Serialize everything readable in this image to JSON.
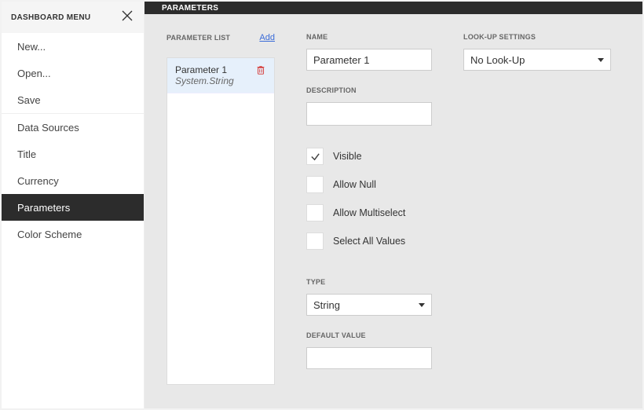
{
  "sidebar": {
    "title": "DASHBOARD MENU",
    "items_a": [
      {
        "label": "New..."
      },
      {
        "label": "Open..."
      },
      {
        "label": "Save"
      }
    ],
    "items_b": [
      {
        "label": "Data Sources"
      },
      {
        "label": "Title"
      },
      {
        "label": "Currency"
      },
      {
        "label": "Parameters"
      },
      {
        "label": "Color Scheme"
      }
    ],
    "active": "Parameters"
  },
  "main": {
    "title": "PARAMETERS"
  },
  "param_list": {
    "label": "PARAMETER LIST",
    "add_label": "Add",
    "items": [
      {
        "name": "Parameter 1",
        "type": "System.String"
      }
    ]
  },
  "fields": {
    "name_label": "NAME",
    "name_value": "Parameter 1",
    "description_label": "DESCRIPTION",
    "description_value": "",
    "checkboxes": {
      "visible": {
        "label": "Visible",
        "checked": true
      },
      "allow_null": {
        "label": "Allow Null",
        "checked": false
      },
      "allow_multiselect": {
        "label": "Allow Multiselect",
        "checked": false
      },
      "select_all": {
        "label": "Select All Values",
        "checked": false
      }
    },
    "type_label": "TYPE",
    "type_value": "String",
    "default_label": "DEFAULT VALUE",
    "default_value": ""
  },
  "lookup": {
    "label": "LOOK-UP SETTINGS",
    "value": "No Look-Up"
  }
}
